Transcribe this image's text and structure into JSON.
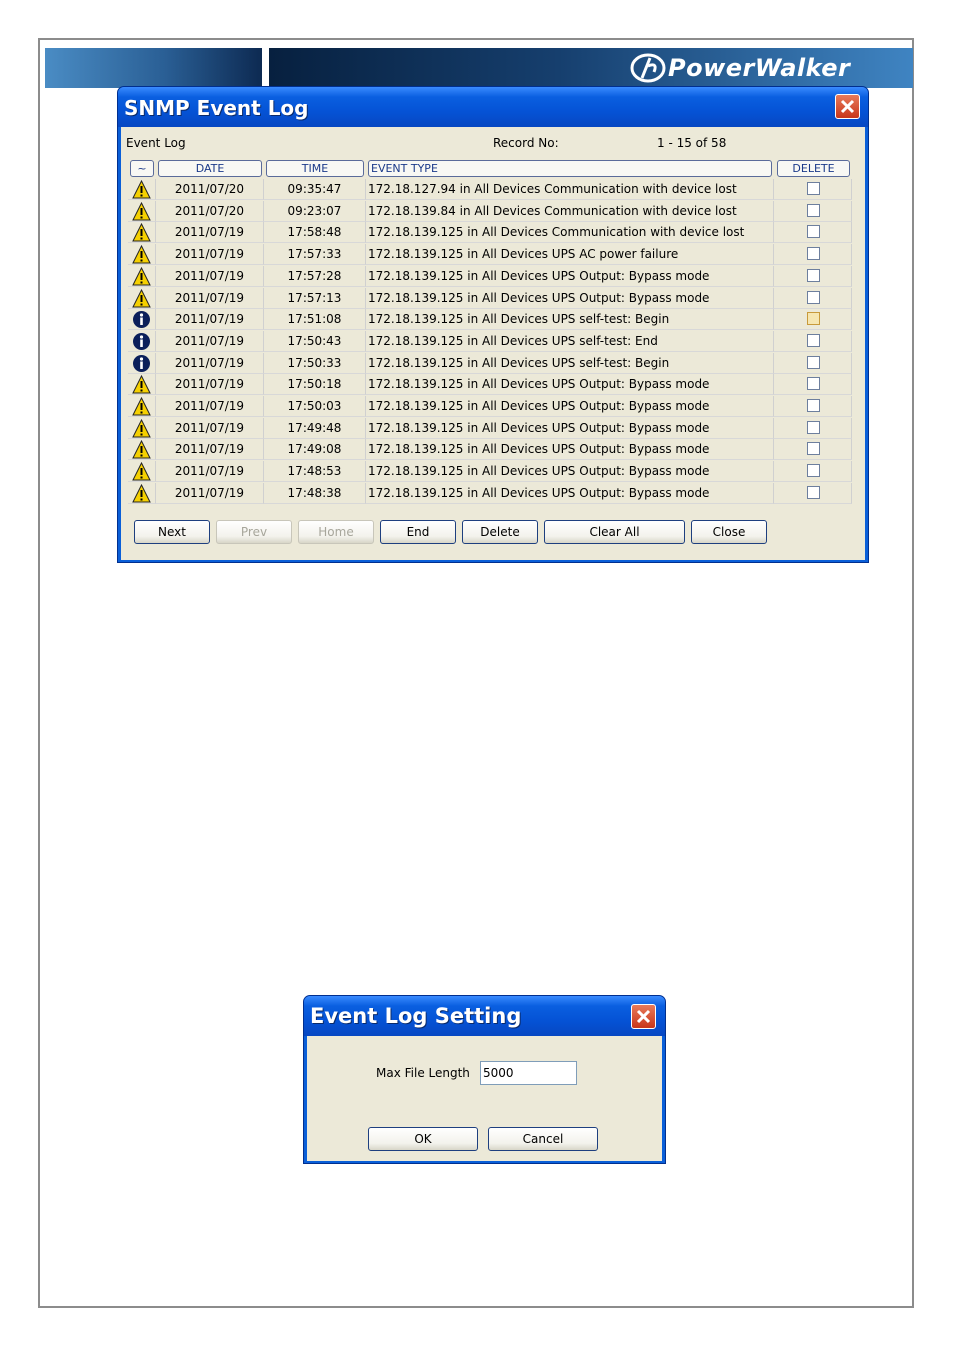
{
  "brand": {
    "logo_text": "PowerWalker"
  },
  "event_log_window": {
    "title": "SNMP Event Log",
    "label": "Event Log",
    "record_label": "Record No:",
    "record_value": "1 - 15 of 58",
    "columns": {
      "icon": "~",
      "date": "DATE",
      "time": "TIME",
      "event": "EVENT TYPE",
      "delete": "DELETE"
    },
    "rows": [
      {
        "icon": "warning",
        "date": "2011/07/20",
        "time": "09:35:47",
        "event": "172.18.127.94 in All Devices Communication with device lost",
        "checked": false,
        "highlighted": false
      },
      {
        "icon": "warning",
        "date": "2011/07/20",
        "time": "09:23:07",
        "event": "172.18.139.84 in All Devices Communication with device lost",
        "checked": false,
        "highlighted": false
      },
      {
        "icon": "warning",
        "date": "2011/07/19",
        "time": "17:58:48",
        "event": "172.18.139.125 in All Devices Communication with device lost",
        "checked": false,
        "highlighted": false
      },
      {
        "icon": "warning",
        "date": "2011/07/19",
        "time": "17:57:33",
        "event": "172.18.139.125 in All Devices UPS AC power failure",
        "checked": false,
        "highlighted": false
      },
      {
        "icon": "warning",
        "date": "2011/07/19",
        "time": "17:57:28",
        "event": "172.18.139.125 in All Devices UPS Output: Bypass mode",
        "checked": false,
        "highlighted": false
      },
      {
        "icon": "warning",
        "date": "2011/07/19",
        "time": "17:57:13",
        "event": "172.18.139.125 in All Devices UPS Output: Bypass mode",
        "checked": false,
        "highlighted": false
      },
      {
        "icon": "info",
        "date": "2011/07/19",
        "time": "17:51:08",
        "event": "172.18.139.125 in All Devices UPS self-test: Begin",
        "checked": false,
        "highlighted": true
      },
      {
        "icon": "info",
        "date": "2011/07/19",
        "time": "17:50:43",
        "event": "172.18.139.125 in All Devices UPS self-test: End",
        "checked": false,
        "highlighted": false
      },
      {
        "icon": "info",
        "date": "2011/07/19",
        "time": "17:50:33",
        "event": "172.18.139.125 in All Devices UPS self-test: Begin",
        "checked": false,
        "highlighted": false
      },
      {
        "icon": "warning",
        "date": "2011/07/19",
        "time": "17:50:18",
        "event": "172.18.139.125 in All Devices UPS Output: Bypass mode",
        "checked": false,
        "highlighted": false
      },
      {
        "icon": "warning",
        "date": "2011/07/19",
        "time": "17:50:03",
        "event": "172.18.139.125 in All Devices UPS Output: Bypass mode",
        "checked": false,
        "highlighted": false
      },
      {
        "icon": "warning",
        "date": "2011/07/19",
        "time": "17:49:48",
        "event": "172.18.139.125 in All Devices UPS Output: Bypass mode",
        "checked": false,
        "highlighted": false
      },
      {
        "icon": "warning",
        "date": "2011/07/19",
        "time": "17:49:08",
        "event": "172.18.139.125 in All Devices UPS Output: Bypass mode",
        "checked": false,
        "highlighted": false
      },
      {
        "icon": "warning",
        "date": "2011/07/19",
        "time": "17:48:53",
        "event": "172.18.139.125 in All Devices UPS Output: Bypass mode",
        "checked": false,
        "highlighted": false
      },
      {
        "icon": "warning",
        "date": "2011/07/19",
        "time": "17:48:38",
        "event": "172.18.139.125 in All Devices UPS Output: Bypass mode",
        "checked": false,
        "highlighted": false
      }
    ],
    "buttons": {
      "next": "Next",
      "prev": "Prev",
      "home": "Home",
      "end": "End",
      "delete": "Delete",
      "clear_all": "Clear All",
      "close": "Close"
    }
  },
  "settings_window": {
    "title": "Event Log Setting",
    "field_label": "Max File Length",
    "field_value": "5000",
    "ok": "OK",
    "cancel": "Cancel"
  },
  "colors": {
    "titlebar": "#0a5fd8",
    "dialog_bg": "#ece9d8",
    "close_button": "#c8361a",
    "warning_icon": "#f5d000",
    "info_icon": "#0b1f5a"
  }
}
